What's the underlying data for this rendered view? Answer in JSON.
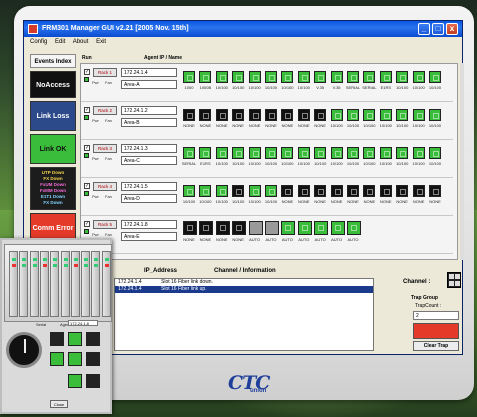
{
  "window": {
    "title": "FRM301  Manager GUI  v2.21 [2005 Nov. 15th]",
    "min_symbol": "_",
    "max_symbol": "□",
    "close_symbol": "x"
  },
  "menu": [
    "Config",
    "Edit",
    "About",
    "Exit"
  ],
  "legend": {
    "header": "Events Index",
    "no_access": "NoAccess",
    "link_loss": "Link Loss",
    "link_ok": "Link OK",
    "downs": [
      "UTP  Down",
      "FX  Down",
      "FxUM Down",
      "FxMM Down",
      "E1T1 Down",
      "FX  Down"
    ],
    "comm_error": "Comm Error"
  },
  "table_headers": {
    "run": "Run",
    "agent": "Agent IP / Name"
  },
  "racks": [
    {
      "button": "Rack 1",
      "ip": "172.24.1.4",
      "area": "Area-A",
      "slots": [
        {
          "state": "green",
          "label": "1000"
        },
        {
          "state": "green",
          "label": "1000B"
        },
        {
          "state": "green",
          "label": "10/100"
        },
        {
          "state": "green",
          "label": "10/100"
        },
        {
          "state": "green",
          "label": "10/100"
        },
        {
          "state": "green",
          "label": "10/100"
        },
        {
          "state": "green",
          "label": "10/100"
        },
        {
          "state": "green",
          "label": "10/100"
        },
        {
          "state": "green",
          "label": "V.35"
        },
        {
          "state": "green",
          "label": "V.35"
        },
        {
          "state": "green",
          "label": "SERIAL"
        },
        {
          "state": "green",
          "label": "SERIAL"
        },
        {
          "state": "green",
          "label": "E1RS"
        },
        {
          "state": "green",
          "label": "10/100"
        },
        {
          "state": "green",
          "label": "10/100"
        },
        {
          "state": "green",
          "label": "10/100"
        }
      ]
    },
    {
      "button": "Rack 2",
      "ip": "172.24.1.2",
      "area": "Area-B",
      "slots": [
        {
          "state": "black",
          "label": "NONE"
        },
        {
          "state": "black",
          "label": "NONE"
        },
        {
          "state": "black",
          "label": "NONE"
        },
        {
          "state": "black",
          "label": "NONE"
        },
        {
          "state": "black",
          "label": "NONE"
        },
        {
          "state": "black",
          "label": "NONE"
        },
        {
          "state": "black",
          "label": "NONE"
        },
        {
          "state": "black",
          "label": "NONE"
        },
        {
          "state": "black",
          "label": "NONE"
        },
        {
          "state": "green",
          "label": "10/100"
        },
        {
          "state": "green",
          "label": "10/100"
        },
        {
          "state": "green",
          "label": "10/100"
        },
        {
          "state": "green",
          "label": "10/100"
        },
        {
          "state": "green",
          "label": "10/100"
        },
        {
          "state": "green",
          "label": "10/100"
        },
        {
          "state": "green",
          "label": "10/100"
        }
      ]
    },
    {
      "button": "Rack 3",
      "ip": "172.24.1.3",
      "area": "Area-C",
      "slots": [
        {
          "state": "green",
          "label": "SERIAL"
        },
        {
          "state": "green",
          "label": "E1RS"
        },
        {
          "state": "green",
          "label": "10/100"
        },
        {
          "state": "green",
          "label": "10/100"
        },
        {
          "state": "green",
          "label": "10/100"
        },
        {
          "state": "green",
          "label": "10/100"
        },
        {
          "state": "green",
          "label": "10/100"
        },
        {
          "state": "green",
          "label": "10/100"
        },
        {
          "state": "green",
          "label": "10/100"
        },
        {
          "state": "green",
          "label": "10/100"
        },
        {
          "state": "green",
          "label": "10/100"
        },
        {
          "state": "green",
          "label": "10/100"
        },
        {
          "state": "green",
          "label": "10/100"
        },
        {
          "state": "green",
          "label": "10/100"
        },
        {
          "state": "green",
          "label": "10/100"
        },
        {
          "state": "green",
          "label": "10/100"
        }
      ]
    },
    {
      "button": "Rack 4",
      "ip": "172.24.1.5",
      "area": "Area-D",
      "slots": [
        {
          "state": "green",
          "label": "10/100"
        },
        {
          "state": "green",
          "label": "10/100"
        },
        {
          "state": "green",
          "label": "10/100"
        },
        {
          "state": "black",
          "label": "10/100"
        },
        {
          "state": "green",
          "label": "10/100"
        },
        {
          "state": "green",
          "label": "10/100"
        },
        {
          "state": "black",
          "label": "NONE"
        },
        {
          "state": "black",
          "label": "NONE"
        },
        {
          "state": "black",
          "label": "NONE"
        },
        {
          "state": "black",
          "label": "NONE"
        },
        {
          "state": "black",
          "label": "NONE"
        },
        {
          "state": "black",
          "label": "NONE"
        },
        {
          "state": "black",
          "label": "NONE"
        },
        {
          "state": "black",
          "label": "NONE"
        },
        {
          "state": "black",
          "label": "NONE"
        },
        {
          "state": "black",
          "label": "NONE"
        }
      ]
    },
    {
      "button": "Rack 5",
      "ip": "172.24.1.8",
      "area": "Area-E",
      "slots": [
        {
          "state": "black",
          "label": "NONE"
        },
        {
          "state": "black",
          "label": "NONE"
        },
        {
          "state": "black",
          "label": "NONE"
        },
        {
          "state": "black",
          "label": "NONE"
        },
        {
          "state": "gray",
          "label": "AUTO"
        },
        {
          "state": "gray",
          "label": "AUTO"
        },
        {
          "state": "green",
          "label": "AUTO"
        },
        {
          "state": "green",
          "label": "AUTO"
        },
        {
          "state": "green",
          "label": "AUTO"
        },
        {
          "state": "green",
          "label": "AUTO"
        },
        {
          "state": "green",
          "label": "AUTO"
        }
      ]
    }
  ],
  "run_labels": {
    "check": "✓",
    "pwr": "Pwr",
    "fan": "Fan"
  },
  "events": {
    "headers": {
      "ip": "IP_Address",
      "channel": "Channel  /  Information"
    },
    "rows": [
      {
        "ip": "172.24.1.4",
        "info": "Slot 16 Fiber link down."
      },
      {
        "ip": "172.24.1.4",
        "info": "Slot 16 Fiber link up."
      }
    ]
  },
  "panel": {
    "channel_label": "Channel :",
    "trap_group": "Trap Group",
    "trap_count_label": "TrapCount :",
    "trap_count_value": "2",
    "clear_trap": "Clear Trap"
  },
  "inset": {
    "label_serial": "Serial",
    "label_agent": "Agent IP",
    "agent_value": "172.24.1.8",
    "close": "Close"
  },
  "brand": {
    "logo": "CTC",
    "sub": "union"
  },
  "colors": {
    "green": "#3bbd3c",
    "black": "#111111",
    "gray": "#9a9a9a",
    "red": "#e33a2a",
    "titlebar": "#0a55e0"
  }
}
